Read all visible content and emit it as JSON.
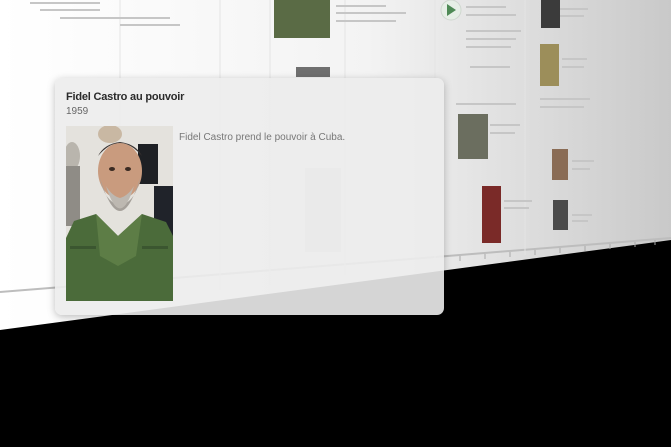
{
  "event": {
    "title": "Fidel Castro au pouvoir",
    "year": "1959",
    "description": "Fidel Castro prend le pouvoir à Cuba.",
    "photo_subject": "portrait of Fidel Castro in olive-green uniform"
  },
  "colors": {
    "background": "#000000",
    "wall": "#f2f2f2",
    "card": "#ececec",
    "title": "#2a2a2a",
    "year": "#666666",
    "description": "#777777"
  }
}
